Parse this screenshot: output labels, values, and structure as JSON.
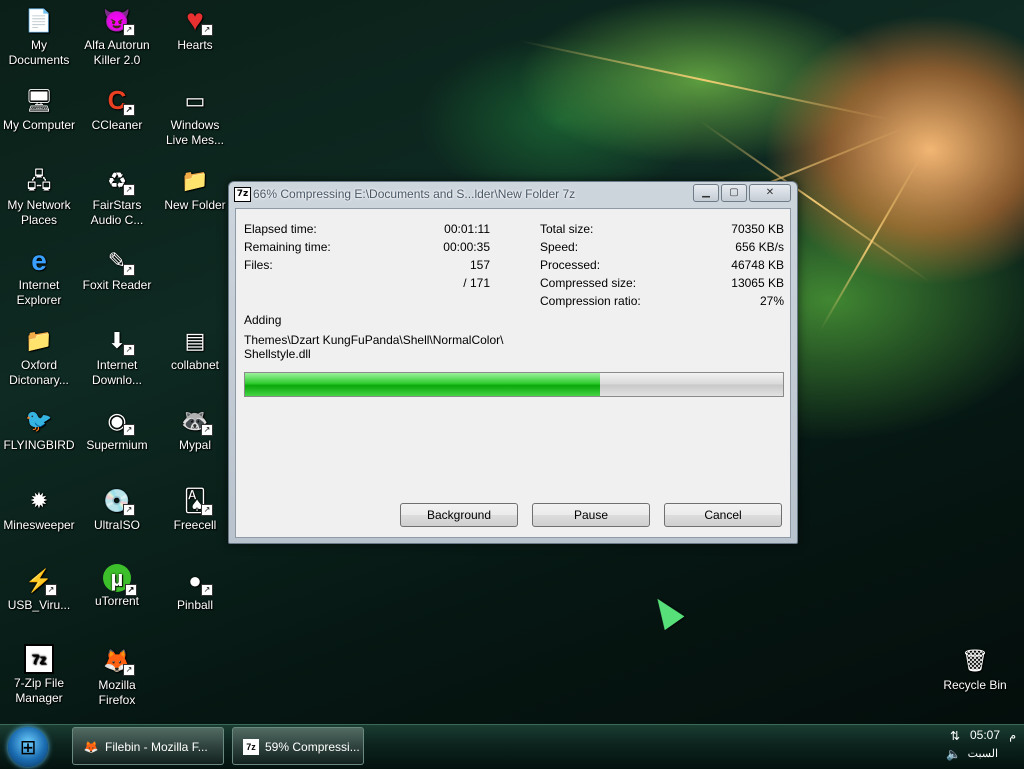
{
  "desktop": {
    "icons": [
      {
        "label": "My\nDocuments",
        "glyph": "📄"
      },
      {
        "label": "Alfa Autorun\nKiller 2.0",
        "glyph": "😈"
      },
      {
        "label": "Hearts",
        "glyph": "♥"
      },
      {
        "label": "My Computer",
        "glyph": "🖥"
      },
      {
        "label": "CCleaner",
        "glyph": "C"
      },
      {
        "label": "Windows\nLive Mes...",
        "glyph": "▭"
      },
      {
        "label": "My Network\nPlaces",
        "glyph": "🖧"
      },
      {
        "label": "FairStars\nAudio C...",
        "glyph": "♻"
      },
      {
        "label": "New Folder",
        "glyph": "📁"
      },
      {
        "label": "Internet\nExplorer",
        "glyph": "e"
      },
      {
        "label": "Foxit Reader",
        "glyph": "✎"
      },
      {
        "label": "Oxford\nDictonary...",
        "glyph": "📁"
      },
      {
        "label": "Internet\nDownlo...",
        "glyph": "⬇"
      },
      {
        "label": "collabnet",
        "glyph": "▤"
      },
      {
        "label": "FLYINGBIRD",
        "glyph": "🐦"
      },
      {
        "label": "Supermium",
        "glyph": "◉"
      },
      {
        "label": "Mypal",
        "glyph": "🦝"
      },
      {
        "label": "Minesweeper",
        "glyph": "✹"
      },
      {
        "label": "UltraISO",
        "glyph": "💿"
      },
      {
        "label": "Freecell",
        "glyph": "🂡"
      },
      {
        "label": "USB_Viru...",
        "glyph": "⚡"
      },
      {
        "label": "uTorrent",
        "glyph": "µ"
      },
      {
        "label": "Pinball",
        "glyph": "●"
      },
      {
        "label": "7-Zip File\nManager",
        "glyph": "7z"
      },
      {
        "label": "Mozilla\nFirefox",
        "glyph": "🦊"
      },
      {
        "label": "Recycle Bin",
        "glyph": "🗑"
      }
    ]
  },
  "dialog": {
    "icon_text": "7z",
    "title": "66% Compressing E:\\Documents and S...lder\\New Folder 7z",
    "minimize": "▁",
    "maximize": "▢",
    "close": "✕",
    "left_stats": {
      "elapsed_label": "Elapsed time:",
      "elapsed_value": "00:01:11",
      "remaining_label": "Remaining time:",
      "remaining_value": "00:00:35",
      "files_label": "Files:",
      "files_value": "157",
      "files_total": "/ 171"
    },
    "right_stats": {
      "total_label": "Total size:",
      "total_value": "70350 KB",
      "speed_label": "Speed:",
      "speed_value": "656 KB/s",
      "processed_label": "Processed:",
      "processed_value": "46748 KB",
      "compressed_label": "Compressed size:",
      "compressed_value": "13065 KB",
      "ratio_label": "Compression ratio:",
      "ratio_value": "27%"
    },
    "adding_label": "Adding",
    "current_path_line1": "Themes\\Dzart KungFuPanda\\Shell\\NormalColor\\",
    "current_path_line2": "Shellstyle.dll",
    "progress_fraction": 0.66,
    "buttons": {
      "background": "Background",
      "pause": "Pause",
      "cancel": "Cancel"
    }
  },
  "taskbar": {
    "tasks": [
      {
        "label": "Filebin - Mozilla F...",
        "glyph": "🦊"
      },
      {
        "label": "59% Compressi...",
        "glyph": "7z"
      }
    ],
    "clock": "05:07",
    "ampm": "م",
    "day": "السبت"
  },
  "colors": {
    "progress_green": "#0aa80a",
    "desktop_dark": "#0a1f18"
  }
}
